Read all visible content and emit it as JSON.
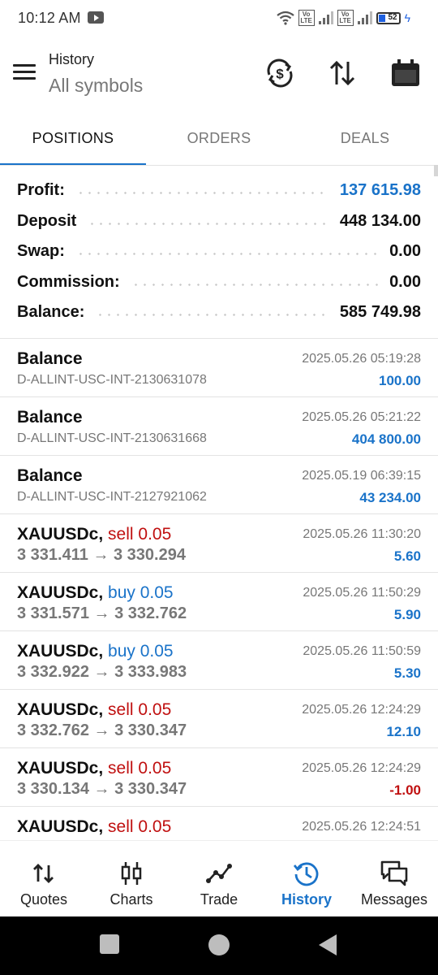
{
  "status_bar": {
    "time": "10:12 AM",
    "battery": "52",
    "volte1": "Vo LTE",
    "volte2": "Vo LTE"
  },
  "header": {
    "title": "History",
    "subtitle": "All symbols",
    "icons": [
      "currency-sync-icon",
      "sort-icon",
      "calendar-icon"
    ]
  },
  "tabs": [
    {
      "label": "POSITIONS",
      "active": true
    },
    {
      "label": "ORDERS",
      "active": false
    },
    {
      "label": "DEALS",
      "active": false
    }
  ],
  "summary": [
    {
      "label": "Profit:",
      "value": "137 615.98",
      "color": "#1a73c9"
    },
    {
      "label": "Deposit",
      "value": "448 134.00"
    },
    {
      "label": "Swap:",
      "value": "0.00"
    },
    {
      "label": "Commission:",
      "value": "0.00"
    },
    {
      "label": "Balance:",
      "value": "585 749.98"
    }
  ],
  "items": [
    {
      "kind": "balance",
      "title": "Balance",
      "sub": "D-ALLINT-USC-INT-2130631078",
      "time": "2025.05.26 05:19:28",
      "amount": "100.00"
    },
    {
      "kind": "balance",
      "title": "Balance",
      "sub": "D-ALLINT-USC-INT-2130631668",
      "time": "2025.05.26 05:21:22",
      "amount": "404 800.00"
    },
    {
      "kind": "balance",
      "title": "Balance",
      "sub": "D-ALLINT-USC-INT-2127921062",
      "time": "2025.05.19 06:39:15",
      "amount": "43 234.00"
    },
    {
      "kind": "trade",
      "symbol": "XAUUSDc,",
      "side": "sell 0.05",
      "open": "3 331.411",
      "arrow": "→",
      "close": "3 330.294",
      "time": "2025.05.26 11:30:20",
      "amount": "5.60"
    },
    {
      "kind": "trade",
      "symbol": "XAUUSDc,",
      "side": "buy 0.05",
      "open": "3 331.571",
      "arrow": "→",
      "close": "3 332.762",
      "time": "2025.05.26 11:50:29",
      "amount": "5.90"
    },
    {
      "kind": "trade",
      "symbol": "XAUUSDc,",
      "side": "buy 0.05",
      "open": "3 332.922",
      "arrow": "→",
      "close": "3 333.983",
      "time": "2025.05.26 11:50:59",
      "amount": "5.30"
    },
    {
      "kind": "trade",
      "symbol": "XAUUSDc,",
      "side": "sell 0.05",
      "open": "3 332.762",
      "arrow": "→",
      "close": "3 330.347",
      "time": "2025.05.26 12:24:29",
      "amount": "12.10"
    },
    {
      "kind": "trade",
      "symbol": "XAUUSDc,",
      "side": "sell 0.05",
      "open": "3 330.134",
      "arrow": "→",
      "close": "3 330.347",
      "time": "2025.05.26 12:24:29",
      "amount": "-1.00"
    },
    {
      "kind": "trade",
      "symbol": "XAUUSDc,",
      "side": "sell 0.05",
      "open": "",
      "arrow": "",
      "close": "",
      "time": "2025.05.26 12:24:51",
      "amount": ""
    }
  ],
  "bottom_nav": [
    {
      "label": "Quotes",
      "icon": "quotes-arrows-icon"
    },
    {
      "label": "Charts",
      "icon": "candlestick-icon"
    },
    {
      "label": "Trade",
      "icon": "trade-line-icon"
    },
    {
      "label": "History",
      "icon": "history-clock-icon",
      "active": true
    },
    {
      "label": "Messages",
      "icon": "chat-bubbles-icon"
    }
  ],
  "colors": {
    "accent": "#1a73c9",
    "sell": "#c01010",
    "negative": "#c01010"
  }
}
